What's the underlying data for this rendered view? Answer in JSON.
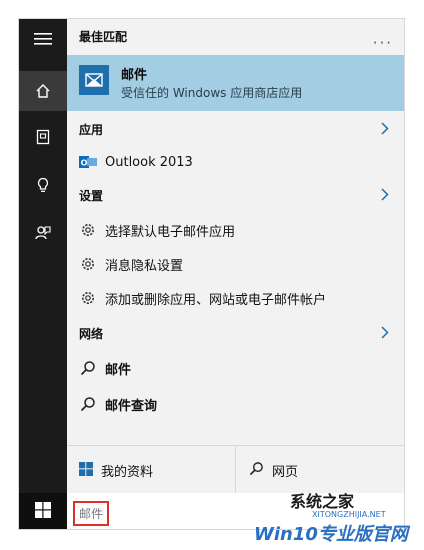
{
  "sidebar": {
    "items": [
      {
        "icon": "hamburger-menu-icon"
      },
      {
        "icon": "home-icon",
        "active": true
      },
      {
        "icon": "notebook-icon"
      },
      {
        "icon": "lightbulb-icon"
      },
      {
        "icon": "feedback-icon"
      }
    ]
  },
  "panel": {
    "best_match_title": "最佳匹配",
    "more_label": "···",
    "best_match": {
      "title": "邮件",
      "subtitle": "受信任的 Windows 应用商店应用"
    },
    "apps_title": "应用",
    "apps": [
      {
        "label": "Outlook 2013",
        "icon": "outlook-icon"
      }
    ],
    "settings_title": "设置",
    "settings": [
      {
        "label": "选择默认电子邮件应用",
        "icon": "gear-icon"
      },
      {
        "label": "消息隐私设置",
        "icon": "gear-icon"
      },
      {
        "label": "添加或删除应用、网站或电子邮件帐户",
        "icon": "gear-icon"
      }
    ],
    "web_title": "网络",
    "web": [
      {
        "label": "邮件",
        "icon": "search-icon"
      },
      {
        "label": "邮件查询",
        "icon": "search-icon"
      }
    ]
  },
  "bottom": {
    "my_stuff_label": "我的资料",
    "web_label": "网页"
  },
  "taskbar": {
    "search_value": "邮件"
  },
  "watermark": {
    "line1": "系统之家",
    "line2": "XITONGZHIJIA.NET",
    "line3": "Win10专业版官网"
  },
  "colors": {
    "sidebar_bg": "#1b1b1b",
    "panel_bg": "#f2f2f2",
    "highlight_bg": "#a3cde3",
    "accent_blue": "#1f6fad",
    "search_outline": "#e0302a"
  }
}
